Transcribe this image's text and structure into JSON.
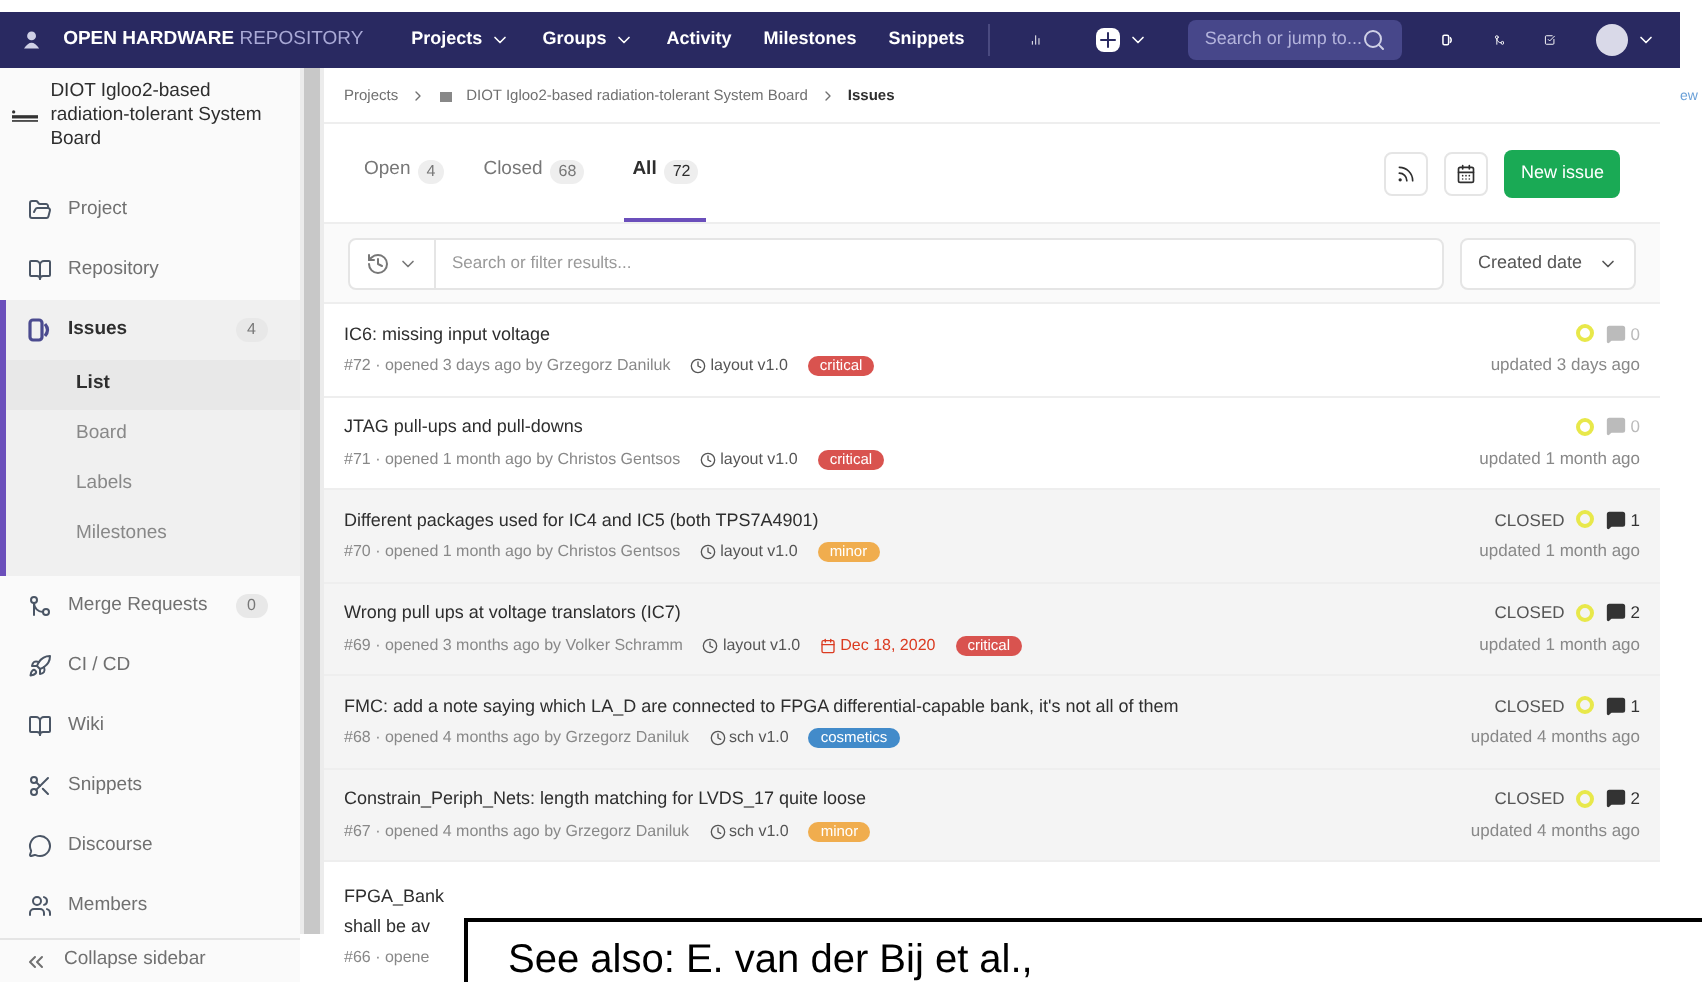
{
  "navbar": {
    "brand_bold": "OPEN HARDWARE",
    "brand_light": "REPOSITORY",
    "items": [
      {
        "label": "Projects",
        "dropdown": true
      },
      {
        "label": "Groups",
        "dropdown": true
      },
      {
        "label": "Activity",
        "dropdown": false
      },
      {
        "label": "Milestones",
        "dropdown": false
      },
      {
        "label": "Snippets",
        "dropdown": false
      }
    ],
    "search": {
      "placeholder": "Search or jump to..."
    }
  },
  "edge_text": "ew",
  "sidebar": {
    "project_name": "DIOT Igloo2-based radiation-tolerant System Board",
    "items": [
      {
        "label": "Project",
        "kind": "project",
        "selected": false
      },
      {
        "label": "Repository",
        "kind": "repository",
        "selected": false
      },
      {
        "label": "Issues",
        "kind": "issues",
        "count": "4",
        "selected": true,
        "children": [
          {
            "label": "List",
            "selected": true
          },
          {
            "label": "Board",
            "selected": false
          },
          {
            "label": "Labels",
            "selected": false
          },
          {
            "label": "Milestones",
            "selected": false
          }
        ]
      },
      {
        "label": "Merge Requests",
        "kind": "merge",
        "count": "0",
        "selected": false
      },
      {
        "label": "CI / CD",
        "kind": "rocket",
        "selected": false
      },
      {
        "label": "Wiki",
        "kind": "wiki",
        "selected": false
      },
      {
        "label": "Snippets",
        "kind": "scissors",
        "selected": false
      },
      {
        "label": "Discourse",
        "kind": "chat",
        "selected": false
      },
      {
        "label": "Members",
        "kind": "members",
        "selected": false
      }
    ],
    "collapse": "Collapse sidebar"
  },
  "breadcrumb": [
    "Projects",
    "DIOT Igloo2-based radiation-tolerant System Board",
    "Issues"
  ],
  "tabs": [
    {
      "label": "Open",
      "count": "4",
      "selected": false
    },
    {
      "label": "Closed",
      "count": "68",
      "selected": false
    },
    {
      "label": "All",
      "count": "72",
      "selected": true
    }
  ],
  "new_issue": "New issue",
  "filter": {
    "placeholder": "Search or filter results...",
    "sort": "Created date"
  },
  "issues": [
    {
      "title": "IC6: missing input voltage",
      "meta": "#72 · opened 3 days ago by Grzegorz Daniluk",
      "milestone": "layout v1.0",
      "label": {
        "text": "critical",
        "color": "#d9534f"
      },
      "comments": "0",
      "updated": "updated 3 days ago"
    },
    {
      "title": "JTAG pull-ups and pull-downs",
      "meta": "#71 · opened 1 month ago by Christos Gentsos",
      "milestone": "layout v1.0",
      "label": {
        "text": "critical",
        "color": "#d9534f"
      },
      "comments": "0",
      "updated": "updated 1 month ago"
    },
    {
      "title": "Different packages used for IC4 and IC5 (both TPS7A4901)",
      "meta": "#70 · opened 1 month ago by Christos Gentsos",
      "milestone": "layout v1.0",
      "label": {
        "text": "minor",
        "color": "#f0ad4e"
      },
      "status": "CLOSED",
      "comments": "1",
      "updated": "updated 1 month ago"
    },
    {
      "title": "Wrong pull ups at voltage translators (IC7)",
      "meta": "#69 · opened 3 months ago by Volker Schramm",
      "milestone": "layout v1.0",
      "due": "Dec 18, 2020",
      "label": {
        "text": "critical",
        "color": "#d9534f"
      },
      "status": "CLOSED",
      "comments": "2",
      "updated": "updated 1 month ago"
    },
    {
      "title": "FMC: add a note saying which LA_D are connected to FPGA differential-capable bank, it's not all of them",
      "meta": "#68 · opened 4 months ago by Grzegorz Daniluk",
      "milestone": "sch v1.0",
      "label": {
        "text": "cosmetics",
        "color": "#428bca"
      },
      "status": "CLOSED",
      "comments": "1",
      "updated": "updated 4 months ago"
    },
    {
      "title": "Constrain_Periph_Nets: length matching for LVDS_17 quite loose",
      "meta": "#67 · opened 4 months ago by Grzegorz Daniluk",
      "milestone": "sch v1.0",
      "label": {
        "text": "minor",
        "color": "#f0ad4e"
      },
      "status": "CLOSED",
      "comments": "2",
      "updated": "updated 4 months ago"
    }
  ],
  "partial_issue": {
    "title_lines": [
      "FPGA_Bank",
      "shall be av"
    ],
    "meta": "#66 · opene"
  },
  "overlay_note": "See also: E. van der Bij et al.,"
}
